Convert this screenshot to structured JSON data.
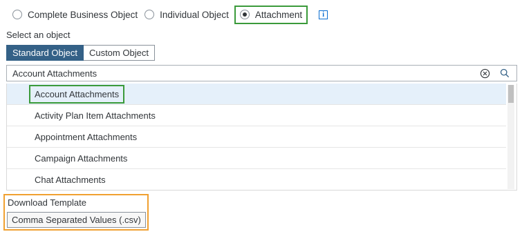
{
  "object_type": {
    "options": [
      {
        "label": "Complete Business Object",
        "checked": false
      },
      {
        "label": "Individual Object",
        "checked": false
      },
      {
        "label": "Attachment",
        "checked": true
      }
    ],
    "info_icon": "i"
  },
  "select_label": "Select an object",
  "segments": {
    "standard": "Standard Object",
    "custom": "Custom Object",
    "active": "standard"
  },
  "search": {
    "value": "Account Attachments"
  },
  "list": {
    "items": [
      "Account Attachments",
      "Activity Plan Item Attachments",
      "Appointment Attachments",
      "Campaign Attachments",
      "Chat Attachments"
    ],
    "selected_index": 0
  },
  "download": {
    "label": "Download Template",
    "button": "Comma Separated Values (.csv)"
  },
  "colors": {
    "accent": "#346187",
    "highlight_green": "#3a9a3a",
    "highlight_orange": "#f0a030",
    "selected_row": "#e5f0fa"
  }
}
